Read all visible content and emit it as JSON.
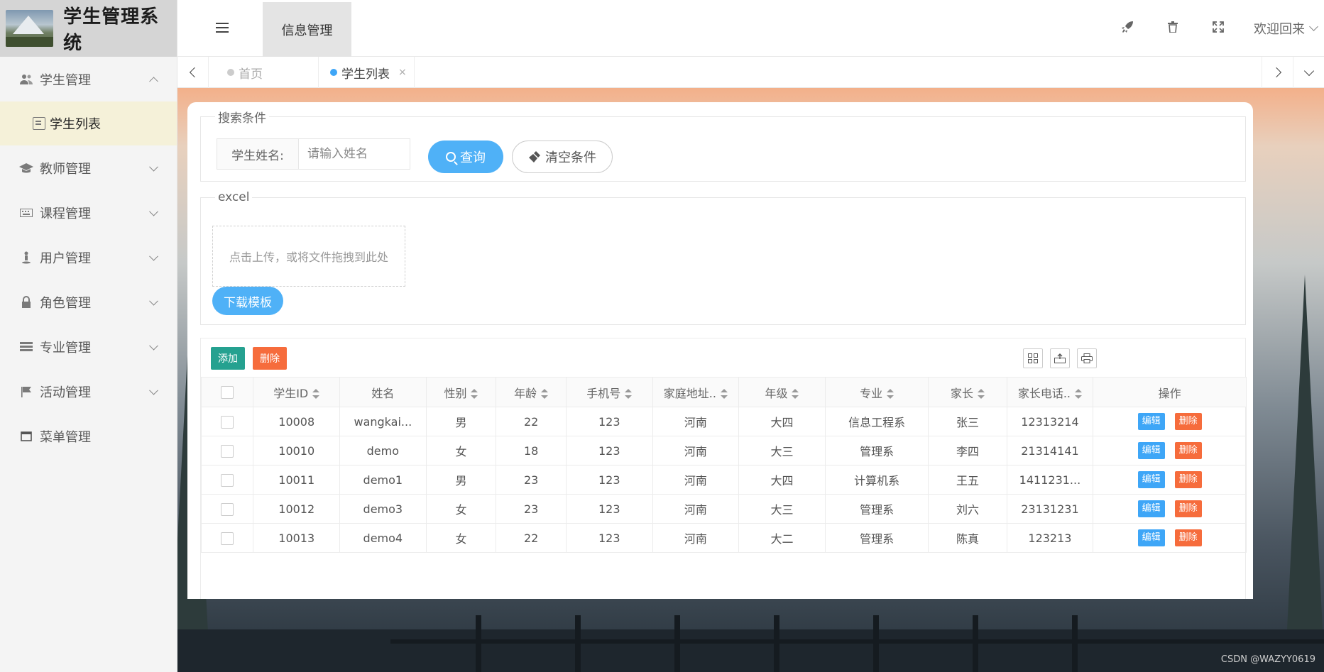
{
  "app": {
    "title": "学生管理系统"
  },
  "topbar": {
    "nav_active": "信息管理",
    "welcome": "欢迎回来",
    "icons": [
      "rocket-icon",
      "trash-icon",
      "fullscreen-icon"
    ]
  },
  "sidebar": {
    "items": [
      {
        "label": "学生管理",
        "icon": "users-icon",
        "expanded": true,
        "children": [
          {
            "label": "学生列表",
            "icon": "clipboard-icon",
            "active": true
          }
        ]
      },
      {
        "label": "教师管理",
        "icon": "graduation-cap-icon"
      },
      {
        "label": "课程管理",
        "icon": "keyboard-icon"
      },
      {
        "label": "用户管理",
        "icon": "person-icon"
      },
      {
        "label": "角色管理",
        "icon": "lock-icon"
      },
      {
        "label": "专业管理",
        "icon": "server-icon"
      },
      {
        "label": "活动管理",
        "icon": "flag-icon"
      },
      {
        "label": "菜单管理",
        "icon": "window-icon"
      }
    ]
  },
  "tabs": [
    {
      "label": "首页",
      "active": false
    },
    {
      "label": "学生列表",
      "active": true,
      "close": "×"
    }
  ],
  "search": {
    "legend": "搜索条件",
    "label": "学生姓名:",
    "placeholder": "请输入姓名",
    "query_label": "查询",
    "clear_label": "清空条件"
  },
  "excel": {
    "legend": "excel",
    "upload_text": "点击上传，或将文件拖拽到此处",
    "download_label": "下载模板"
  },
  "table": {
    "add_label": "添加",
    "delete_label": "删除",
    "columns": [
      "学生ID",
      "姓名",
      "性别",
      "年龄",
      "手机号",
      "家庭地址..",
      "年级",
      "专业",
      "家长",
      "家长电话..",
      "操作"
    ],
    "rows": [
      [
        "10008",
        "wangkai...",
        "男",
        "22",
        "123",
        "河南",
        "大四",
        "信息工程系",
        "张三",
        "12313214"
      ],
      [
        "10010",
        "demo",
        "女",
        "18",
        "123",
        "河南",
        "大三",
        "管理系",
        "李四",
        "21314141"
      ],
      [
        "10011",
        "demo1",
        "男",
        "23",
        "123",
        "河南",
        "大四",
        "计算机系",
        "王五",
        "1411231..."
      ],
      [
        "10012",
        "demo3",
        "女",
        "23",
        "123",
        "河南",
        "大三",
        "管理系",
        "刘六",
        "23131231"
      ],
      [
        "10013",
        "demo4",
        "女",
        "22",
        "123",
        "河南",
        "大二",
        "管理系",
        "陈真",
        "123213"
      ]
    ],
    "row_edit": "编辑",
    "row_delete": "删除"
  },
  "watermark": "CSDN @WAZYY0619",
  "colors": {
    "primary": "#4fb1f7",
    "success": "#25a190",
    "danger": "#f66c3c",
    "active_bg": "#f5f1d9"
  }
}
